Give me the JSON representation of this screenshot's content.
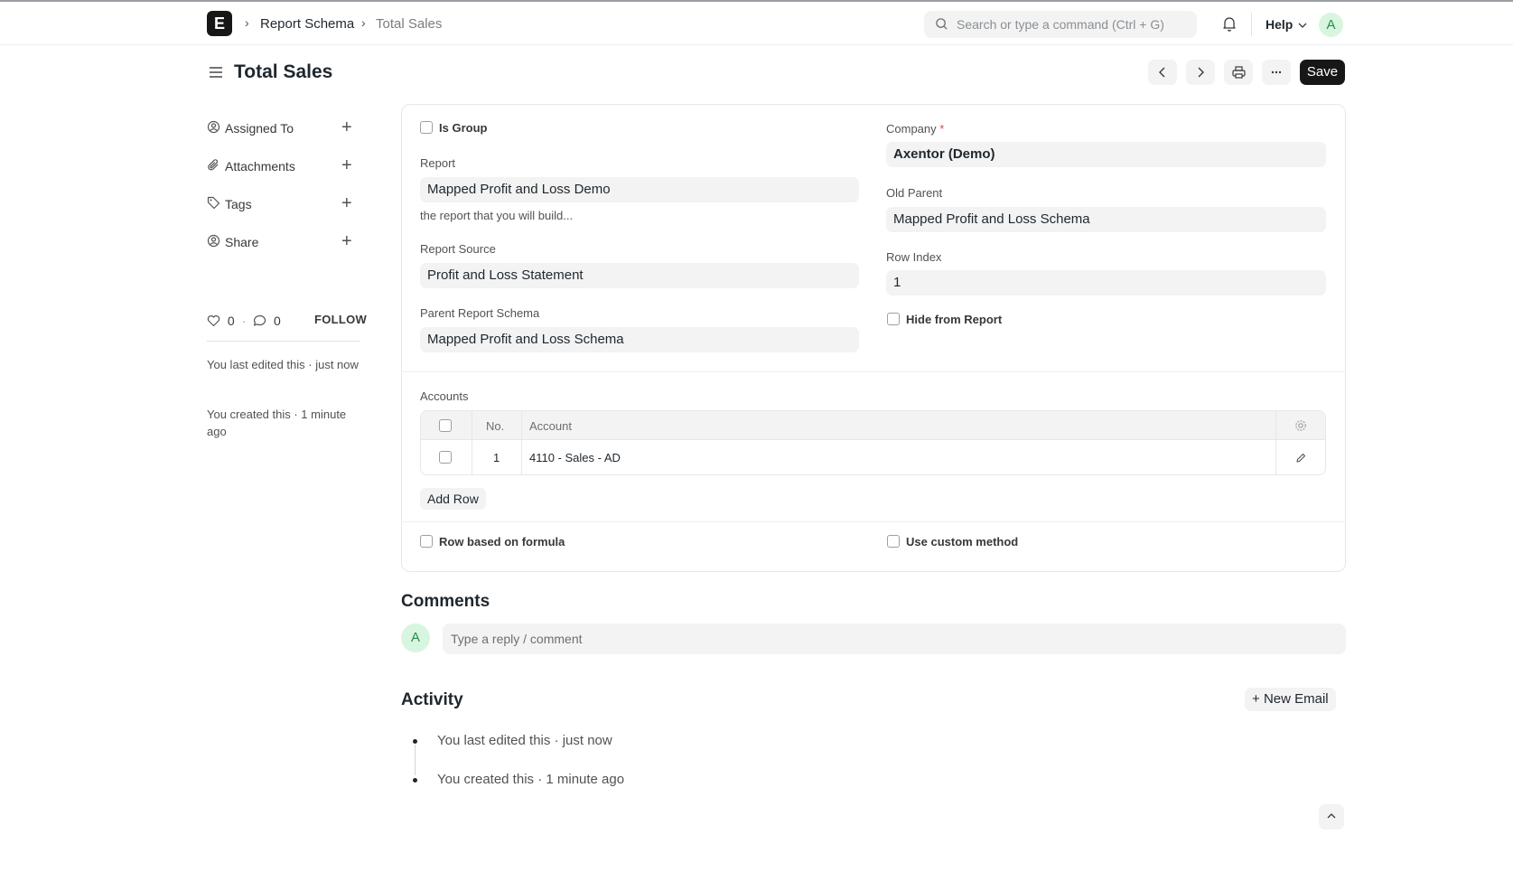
{
  "navbar": {
    "logo_letter": "E",
    "breadcrumbs": [
      "Report Schema",
      "Total Sales"
    ],
    "search_placeholder": "Search or type a command (Ctrl + G)",
    "help_label": "Help",
    "avatar_letter": "A"
  },
  "page": {
    "title": "Total Sales",
    "save_label": "Save"
  },
  "sidebar": {
    "items": [
      {
        "label": "Assigned To",
        "icon": "assign-icon"
      },
      {
        "label": "Attachments",
        "icon": "paperclip-icon"
      },
      {
        "label": "Tags",
        "icon": "tag-icon"
      },
      {
        "label": "Share",
        "icon": "share-icon"
      }
    ],
    "likes_count": "0",
    "comments_count": "0",
    "follow_label": "FOLLOW",
    "last_edited": "You last edited this · just now",
    "created": "You created this · 1 minute ago"
  },
  "form": {
    "is_group_label": "Is Group",
    "report_label": "Report",
    "report_value": "Mapped Profit and Loss Demo",
    "report_description": "the report that you will build...",
    "report_source_label": "Report Source",
    "report_source_value": "Profit and Loss Statement",
    "parent_label": "Parent Report Schema",
    "parent_value": "Mapped Profit and Loss Schema",
    "company_label": "Company",
    "company_required": "*",
    "company_value": "Axentor (Demo)",
    "old_parent_label": "Old Parent",
    "old_parent_value": "Mapped Profit and Loss Schema",
    "row_index_label": "Row Index",
    "row_index_value": "1",
    "hide_label": "Hide from Report",
    "accounts_label": "Accounts",
    "accounts_columns": [
      "No.",
      "Account"
    ],
    "accounts_rows": [
      {
        "no": "1",
        "account": "4110 - Sales - AD"
      }
    ],
    "add_row_label": "Add Row",
    "formula_label": "Row based on formula",
    "custom_method_label": "Use custom method"
  },
  "comments": {
    "title": "Comments",
    "avatar_letter": "A",
    "placeholder": "Type a reply / comment"
  },
  "activity": {
    "title": "Activity",
    "new_email_label": "New Email",
    "entries": [
      "You last edited this · just now",
      "You created this · 1 minute ago"
    ]
  }
}
